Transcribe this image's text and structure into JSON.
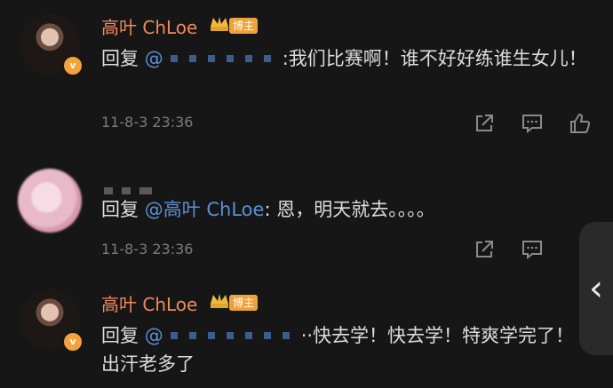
{
  "comments": [
    {
      "author": "高叶 ChLoe",
      "tag": "博主",
      "reply_prefix": "回复 ",
      "mention_at": "@",
      "mention_suffix": ":",
      "text": "我们比赛啊！谁不好好练谁生女儿！",
      "time": "11-8-3 23:36"
    },
    {
      "reply_prefix": "回复 ",
      "mention": "@高叶 ChLoe",
      "mention_suffix": ": ",
      "text": "恩，明天就去。。。。",
      "time": "11-8-3 23:36"
    },
    {
      "author": "高叶 ChLoe",
      "tag": "博主",
      "reply_prefix": "回复 ",
      "mention_at": "@",
      "text": "··快去学！快去学！特爽学完了！出汗老多了"
    }
  ],
  "icons": [
    "share-icon",
    "comment-icon",
    "like-icon",
    "chevron-left-icon"
  ],
  "badge_letter": "v"
}
